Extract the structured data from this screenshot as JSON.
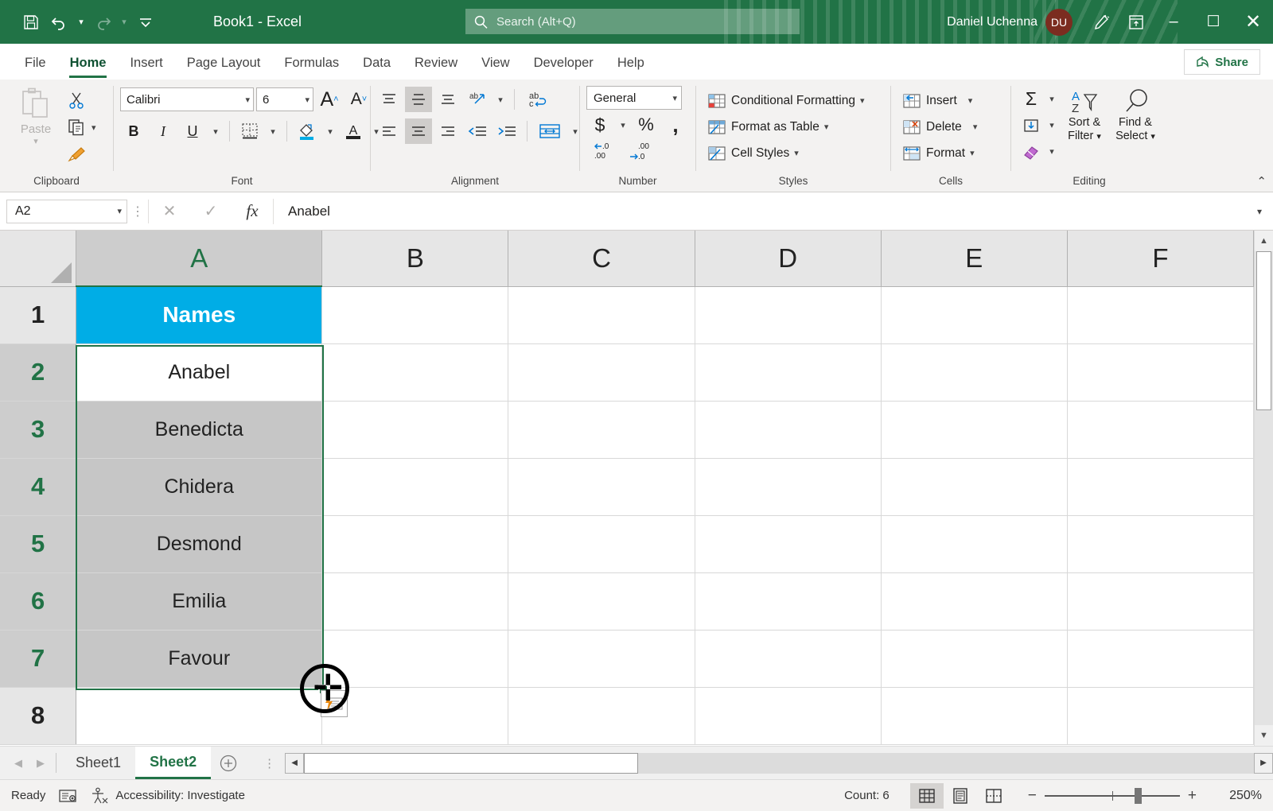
{
  "titlebar": {
    "document_title": "Book1  -  Excel",
    "save_icon": "save-icon",
    "undo_icon": "undo-icon",
    "redo_icon": "redo-icon",
    "customize_icon": "customize-quick-access-icon",
    "search_placeholder": "Search (Alt+Q)",
    "user_name": "Daniel Uchenna",
    "user_initials": "DU",
    "minimize": "–",
    "maximize": "☐",
    "close": "✕"
  },
  "tabs": [
    {
      "label": "File",
      "active": false
    },
    {
      "label": "Home",
      "active": true
    },
    {
      "label": "Insert",
      "active": false
    },
    {
      "label": "Page Layout",
      "active": false
    },
    {
      "label": "Formulas",
      "active": false
    },
    {
      "label": "Data",
      "active": false
    },
    {
      "label": "Review",
      "active": false
    },
    {
      "label": "View",
      "active": false
    },
    {
      "label": "Developer",
      "active": false
    },
    {
      "label": "Help",
      "active": false
    }
  ],
  "share_button": "Share",
  "ribbon": {
    "clipboard": {
      "label": "Clipboard",
      "paste": "Paste",
      "cut_icon": "cut-icon",
      "copy_icon": "copy-icon",
      "format_painter_icon": "format-painter-icon"
    },
    "font": {
      "label": "Font",
      "font_name": "Calibri",
      "font_size": "6",
      "grow_font": "A",
      "shrink_font": "A",
      "bold": "B",
      "italic": "I",
      "underline": "U",
      "borders_icon": "borders-icon",
      "fill_color_icon": "fill-color-icon",
      "font_color_icon": "font-color-icon",
      "fill_color_value": "#00ADE6",
      "font_color_value": "#222222"
    },
    "alignment": {
      "label": "Alignment",
      "top_align": "top-align-icon",
      "middle_align": "middle-align-icon",
      "bottom_align": "bottom-align-icon",
      "orientation": "orientation-icon",
      "align_left": "align-left-icon",
      "align_center": "align-center-icon",
      "align_right": "align-right-icon",
      "decrease_indent": "decrease-indent-icon",
      "increase_indent": "increase-indent-icon",
      "wrap_text": "wrap-text-icon",
      "merge_center": "merge-and-center-icon"
    },
    "number": {
      "label": "Number",
      "format": "General",
      "currency": "$",
      "percent": "%",
      "comma": ",",
      "increase_decimal": "increase-decimal-icon",
      "decrease_decimal": "decrease-decimal-icon"
    },
    "styles": {
      "label": "Styles",
      "items": [
        "Conditional Formatting",
        "Format as Table",
        "Cell Styles"
      ]
    },
    "cells": {
      "label": "Cells",
      "items": [
        "Insert",
        "Delete",
        "Format"
      ]
    },
    "editing": {
      "label": "Editing",
      "autosum": "Σ",
      "fill_icon": "fill-down-icon",
      "clear_icon": "clear-eraser-icon",
      "sort_filter_line1": "Sort &",
      "sort_filter_line2": "Filter",
      "find_select_line1": "Find &",
      "find_select_line2": "Select"
    },
    "collapse_icon": "collapse-ribbon-icon"
  },
  "formula_bar": {
    "name_box": "A2",
    "cancel_icon": "cancel-icon",
    "enter_icon": "confirm-check-icon",
    "function_icon": "insert-function-fx",
    "value": "Anabel",
    "expand_icon": "expand-formula-bar-icon"
  },
  "grid": {
    "columns": [
      "A",
      "B",
      "C",
      "D",
      "E",
      "F"
    ],
    "selected_column": "A",
    "rows": [
      {
        "num": "1",
        "a": "Names",
        "style": "header-fill"
      },
      {
        "num": "2",
        "a": "Anabel",
        "style": "active"
      },
      {
        "num": "3",
        "a": "Benedicta",
        "style": "selected"
      },
      {
        "num": "4",
        "a": "Chidera",
        "style": "selected"
      },
      {
        "num": "5",
        "a": "Desmond",
        "style": "selected"
      },
      {
        "num": "6",
        "a": "Emilia",
        "style": "selected"
      },
      {
        "num": "7",
        "a": "Favour",
        "style": "selected"
      },
      {
        "num": "8",
        "a": "",
        "style": "empty"
      }
    ],
    "header_fill_color": "#00ADE6",
    "selection_border_color": "#217346",
    "selection_range": "A2:A7",
    "fill_handle_icon": "fill-handle",
    "autofill_options_icon": "auto-fill-options-icon",
    "cursor_icon": "fill-crosshair-cursor"
  },
  "sheet_tabs": {
    "prev_icon": "previous-sheet-icon",
    "next_icon": "next-sheet-icon",
    "sheets": [
      {
        "name": "Sheet1",
        "active": false
      },
      {
        "name": "Sheet2",
        "active": true
      }
    ],
    "add_sheet": "+"
  },
  "status_bar": {
    "state": "Ready",
    "macro_icon": "record-macro-icon",
    "accessibility_icon": "accessibility-icon",
    "accessibility_text": "Accessibility: Investigate",
    "count_label": "Count: 6",
    "view_normal": "normal-view-icon",
    "view_page_layout": "page-layout-view-icon",
    "view_page_break": "page-break-preview-icon",
    "zoom_out": "−",
    "zoom_in": "+",
    "zoom_level": "250%"
  }
}
